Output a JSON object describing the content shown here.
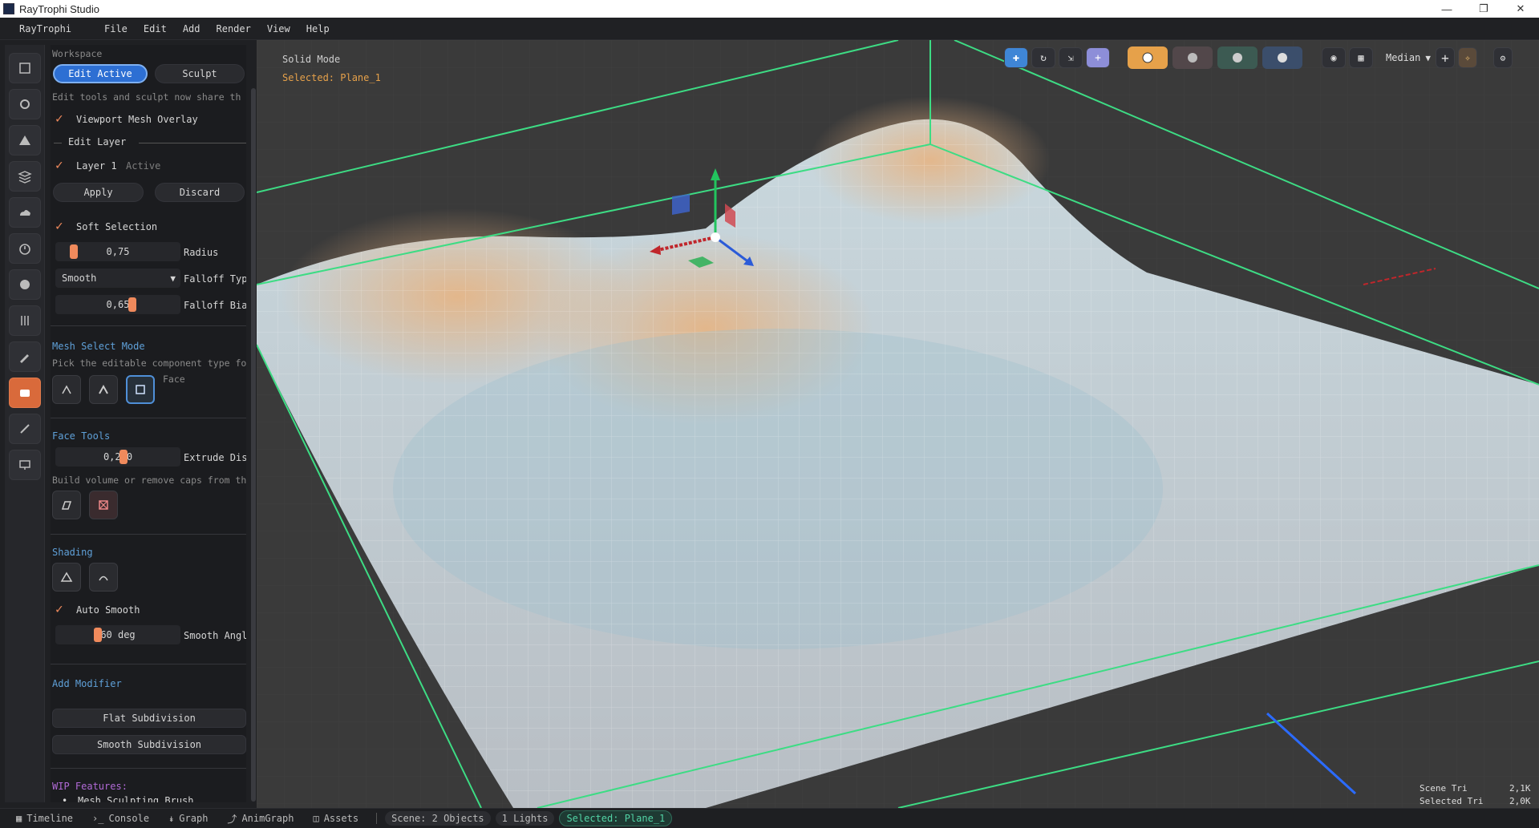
{
  "window": {
    "title": "RayTrophi Studio"
  },
  "menu": {
    "brand": "RayTrophi",
    "items": [
      "File",
      "Edit",
      "Add",
      "Render",
      "View",
      "Help"
    ]
  },
  "panel": {
    "workspace_label": "Workspace",
    "tabs": [
      "Edit Active",
      "Sculpt"
    ],
    "workspace_hint": "Edit tools and sculpt now share th",
    "viewport_overlay": "Viewport Mesh Overlay",
    "edit_layer": "Edit Layer",
    "layer_name": "Layer 1",
    "layer_state": "Active",
    "apply": "Apply",
    "discard": "Discard",
    "soft_selection": "Soft Selection",
    "radius_value": "0,75",
    "radius_label": "Radius",
    "radius_level": 0.12,
    "falloff_type_value": "Smooth",
    "falloff_type_label": "Falloff Typ",
    "falloff_bias_value": "0,65",
    "falloff_bias_label": "Falloff Bia",
    "falloff_bias_level": 0.62,
    "mesh_select_title": "Mesh Select Mode",
    "mesh_select_hint": "Pick the editable component type fo",
    "mesh_select_current": "Face",
    "face_tools_title": "Face Tools",
    "extrude_value": "0,200",
    "extrude_label": "Extrude Dis",
    "extrude_level": 0.55,
    "face_tools_hint": "Build volume or remove caps from th",
    "shading_title": "Shading",
    "auto_smooth": "Auto Smooth",
    "smooth_angle_value": "60 deg",
    "smooth_angle_label": "Smooth Angl",
    "smooth_angle_level": 0.33,
    "add_modifier_title": "Add Modifier",
    "flat_subdivision": "Flat Subdivision",
    "smooth_subdivision": "Smooth Subdivision",
    "wip_title": "WIP Features:",
    "wip_item": "Mesh Sculpting Brush"
  },
  "viewport": {
    "mode": "Solid Mode",
    "selected": "Selected: Plane_1",
    "pivot_label": "Median",
    "stats": {
      "scene_label": "Scene Tri",
      "scene_value": "2,1K",
      "sel_label": "Selected Tri",
      "sel_value": "2,0K"
    }
  },
  "status": {
    "tabs": [
      "Timeline",
      "Console",
      "Graph",
      "AnimGraph",
      "Assets"
    ],
    "scene": "Scene: 2 Objects",
    "lights": "1 Lights",
    "selected": "Selected: Plane_1"
  },
  "colors": {
    "accent": "#f08a5c",
    "select": "#2d6fd3",
    "green_box": "#3ddc84",
    "section": "#5fa0d8",
    "wip": "#b16ad6"
  }
}
